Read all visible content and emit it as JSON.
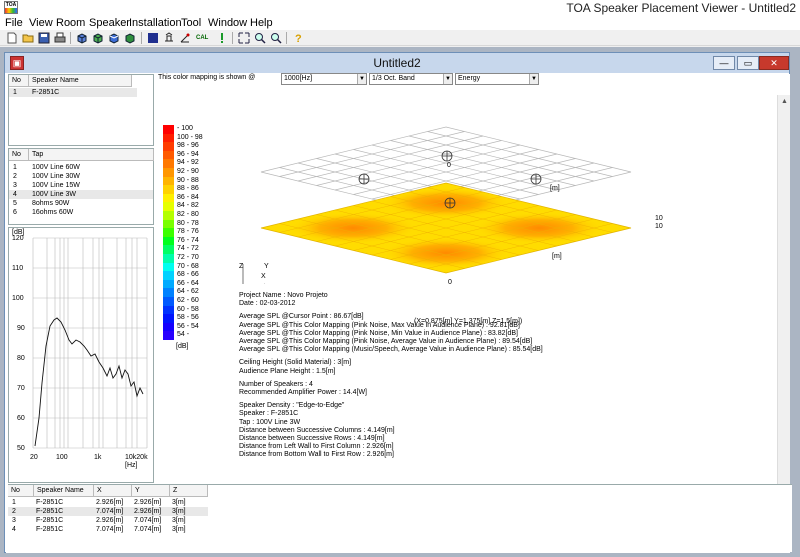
{
  "app": {
    "title": "TOA Speaker Placement Viewer - Untitled2",
    "icon_text": "TOA"
  },
  "menu": [
    "File",
    "View",
    "Room",
    "Speaker",
    "Installation",
    "Tool",
    "Window",
    "Help"
  ],
  "toolbar": {
    "icons": [
      "new-file-icon",
      "open-folder-icon",
      "save-icon",
      "print-icon",
      "view-3d-front-icon",
      "view-3d-side-icon",
      "view-3d-top-icon",
      "view-3d-iso-icon",
      "solid-view-icon",
      "speaker-placement-icon",
      "speaker-angle-icon",
      "calculate-icon",
      "warning-icon",
      "zoom-fit-icon",
      "zoom-in-icon",
      "zoom-out-icon",
      "help-icon"
    ],
    "calc_label": "CAL"
  },
  "window": {
    "title": "Untitled2",
    "minimize": "—",
    "restore": "▭",
    "close": "✕"
  },
  "speaker_list": {
    "headers": [
      "No",
      "Speaker Name"
    ],
    "rows": [
      {
        "no": "1",
        "name": "F-2851C"
      }
    ]
  },
  "tap_list": {
    "headers": [
      "No",
      "Tap"
    ],
    "rows": [
      {
        "no": "1",
        "tap": "100V Line  60W"
      },
      {
        "no": "2",
        "tap": "100V Line  30W"
      },
      {
        "no": "3",
        "tap": "100V Line  15W"
      },
      {
        "no": "4",
        "tap": "100V Line  3W"
      },
      {
        "no": "5",
        "tap": "8ohms  90W"
      },
      {
        "no": "6",
        "tap": "16ohms  60W"
      }
    ],
    "selected": 3
  },
  "freq_graph": {
    "y_unit": "[dB]",
    "y_ticks": [
      "120",
      "110",
      "100",
      "90",
      "80",
      "70",
      "60",
      "50"
    ],
    "x_ticks": [
      "20",
      "100",
      "1k",
      "10k20k"
    ],
    "x_unit": "[Hz]"
  },
  "mapping": {
    "label": "This color mapping is shown @",
    "frequency": "1000[Hz]",
    "band": "1/3 Oct. Band",
    "mode": "Energy"
  },
  "legend": {
    "items": [
      {
        "label": "- 100",
        "color": "#ff0000"
      },
      {
        "label": "100 - 98",
        "color": "#ff1e00"
      },
      {
        "label": "98 - 96",
        "color": "#ff3c00"
      },
      {
        "label": "96 - 94",
        "color": "#ff5a00"
      },
      {
        "label": "94 - 92",
        "color": "#ff7800"
      },
      {
        "label": "92 - 90",
        "color": "#ff9600"
      },
      {
        "label": "90 - 88",
        "color": "#ffb400"
      },
      {
        "label": "88 - 86",
        "color": "#ffd200"
      },
      {
        "label": "86 - 84",
        "color": "#fff000"
      },
      {
        "label": "84 - 82",
        "color": "#e6ff00"
      },
      {
        "label": "82 - 80",
        "color": "#b4ff00"
      },
      {
        "label": "80 - 78",
        "color": "#78ff00"
      },
      {
        "label": "78 - 76",
        "color": "#3cff00"
      },
      {
        "label": "76 - 74",
        "color": "#00ff1e"
      },
      {
        "label": "74 - 72",
        "color": "#00ff64"
      },
      {
        "label": "72 - 70",
        "color": "#00ffaa"
      },
      {
        "label": "70 - 68",
        "color": "#00fff0"
      },
      {
        "label": "68 - 66",
        "color": "#00d2ff"
      },
      {
        "label": "66 - 64",
        "color": "#00aaff"
      },
      {
        "label": "64 - 62",
        "color": "#0082ff"
      },
      {
        "label": "62 - 60",
        "color": "#005aff"
      },
      {
        "label": "60 - 58",
        "color": "#0032ff"
      },
      {
        "label": "58 - 56",
        "color": "#0014ff"
      },
      {
        "label": "56 - 54",
        "color": "#1400ff"
      },
      {
        "label": "54 -",
        "color": "#2800ff"
      }
    ],
    "unit": "[dB]"
  },
  "room_view": {
    "label_m_top": "[m]",
    "label_m_bottom": "[m]",
    "label_0_top": "0",
    "label_0_bottom": "0",
    "label_10a": "10",
    "label_10b": "10",
    "axis_z": "Z",
    "axis_y": "Y",
    "axis_x": "X"
  },
  "info": [
    "Project Name : Novo Projeto",
    "Date : 02-03-2012",
    "",
    "Average SPL @Cursor Point : 86.67[dB]",
    "Average SPL @This Color Mapping (Pink Noise, Max Value in Audience Plane) : 92.81[dB]",
    "Average SPL @This Color Mapping (Pink Noise, Min Value in Audience Plane) : 83.82[dB]",
    "Average SPL @This Color Mapping (Pink Noise, Average Value in Audience Plane) : 89.54[dB]",
    "Average SPL @This Color Mapping (Music/Speech, Average Value in Audience Plane) : 85.54[dB]",
    "",
    "Ceiling Height (Solid Material) : 3[m]",
    "Audience Plane Height : 1.5[m]",
    "",
    "Number of Speakers : 4",
    "Recommended Amplifier Power : 14.4[W]",
    "",
    "Speaker Density : \"Edge-to-Edge\"",
    "Speaker : F-2851C",
    "Tap : 100V Line  3W",
    "Distance between Successive Columns : 4.149[m]",
    "Distance between Successive Rows : 4.149[m]",
    "Distance from Left Wall to First Column : 2.926[m]",
    "Distance from Bottom Wall to First Row : 2.926[m]"
  ],
  "cursor_xyz": "(X=0.875[m]  Y=1.375[m]  Z=1.5[m])",
  "position_table": {
    "headers": [
      "No",
      "Speaker Name",
      "X",
      "Y",
      "Z"
    ],
    "rows": [
      {
        "no": "1",
        "name": "F-2851C",
        "x": "2.926[m]",
        "y": "2.926[m]",
        "z": "3[m]"
      },
      {
        "no": "2",
        "name": "F-2851C",
        "x": "7.074[m]",
        "y": "2.926[m]",
        "z": "3[m]"
      },
      {
        "no": "3",
        "name": "F-2851C",
        "x": "2.926[m]",
        "y": "7.074[m]",
        "z": "3[m]"
      },
      {
        "no": "4",
        "name": "F-2851C",
        "x": "7.074[m]",
        "y": "7.074[m]",
        "z": "3[m]"
      }
    ],
    "selected": 1
  }
}
